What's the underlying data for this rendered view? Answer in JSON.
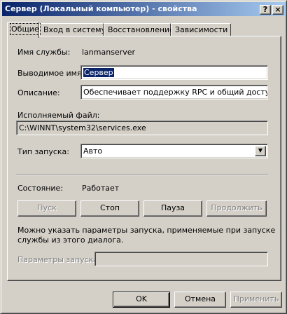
{
  "window": {
    "title": "Сервер (Локальный компьютер) - свойства",
    "help_button": "?",
    "close_button": "×"
  },
  "tabs": [
    {
      "label": "Общие",
      "active": true
    },
    {
      "label": "Вход в систему",
      "active": false
    },
    {
      "label": "Восстановление",
      "active": false
    },
    {
      "label": "Зависимости",
      "active": false
    }
  ],
  "general": {
    "service_name_label": "Имя службы:",
    "service_name_value": "lanmanserver",
    "display_name_label": "Выводимое имя:",
    "display_name_value": "Сервер",
    "description_label": "Описание:",
    "description_value": "Обеспечивает поддержку RPC и общий доступ к файлам",
    "executable_label": "Исполняемый файл:",
    "executable_value": "C:\\WINNT\\system32\\services.exe",
    "startup_type_label": "Тип запуска:",
    "startup_type_value": "Авто",
    "status_label": "Состояние:",
    "status_value": "Работает",
    "start_button": "Пуск",
    "stop_button": "Стоп",
    "pause_button": "Пауза",
    "resume_button": "Продолжить",
    "hint_text_line1": "Можно указать параметры запуска, применяемые при запуске",
    "hint_text_line2": "службы из этого диалога.",
    "start_params_label": "Параметры запуска:",
    "start_params_value": ""
  },
  "footer": {
    "ok_button": "OK",
    "cancel_button": "Отмена",
    "apply_button": "Применить"
  },
  "colors": {
    "titlebar_start": "#0a246a",
    "titlebar_end": "#a6caf0",
    "face": "#d4d0c8",
    "selection": "#0a246a"
  }
}
